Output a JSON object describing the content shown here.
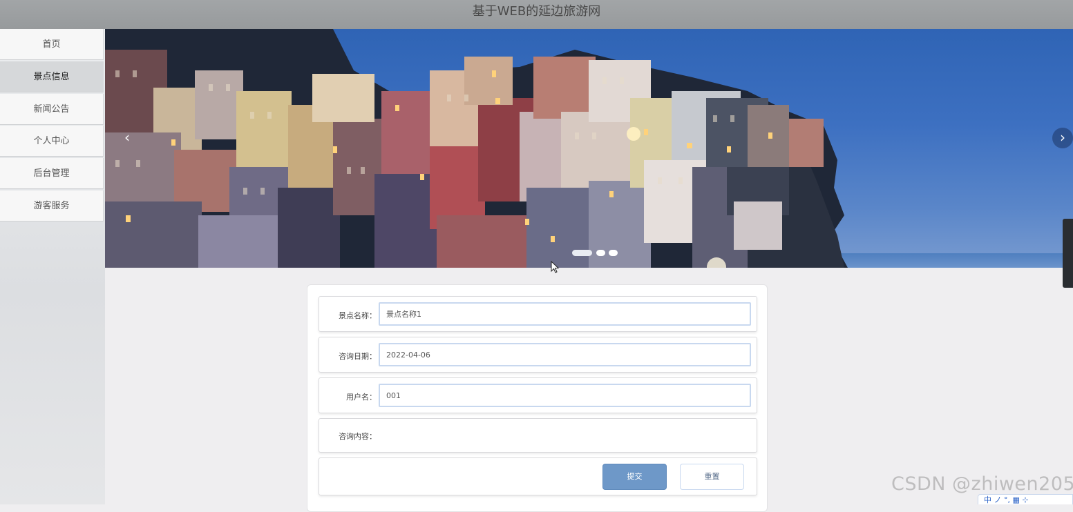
{
  "header": {
    "title": "基于WEB的延边旅游网"
  },
  "sidebar": {
    "items": [
      {
        "label": "首页"
      },
      {
        "label": "景点信息"
      },
      {
        "label": "新闻公告"
      },
      {
        "label": "个人中心"
      },
      {
        "label": "后台管理"
      },
      {
        "label": "游客服务"
      }
    ],
    "active_index": 1
  },
  "carousel": {
    "prev_icon": "chevron-left-icon",
    "next_icon": "chevron-right-icon",
    "slide_count": 3,
    "active_slide": 1
  },
  "form": {
    "fields": [
      {
        "label": "景点名称：",
        "value": "景点名称1"
      },
      {
        "label": "咨询日期：",
        "value": "2022-04-06"
      },
      {
        "label": "用户名：",
        "value": "001"
      },
      {
        "label": "咨询内容：",
        "value": ""
      }
    ],
    "submit_label": "提交",
    "reset_label": "重置"
  },
  "watermark": "CSDN @zhiwen205",
  "ime": "中 ノ °, ▦ ⊹",
  "colors": {
    "header_bg": "#9b9ea0",
    "submit_bg": "#6e98c8",
    "active_sidebar_bg": "#d6d8da"
  }
}
